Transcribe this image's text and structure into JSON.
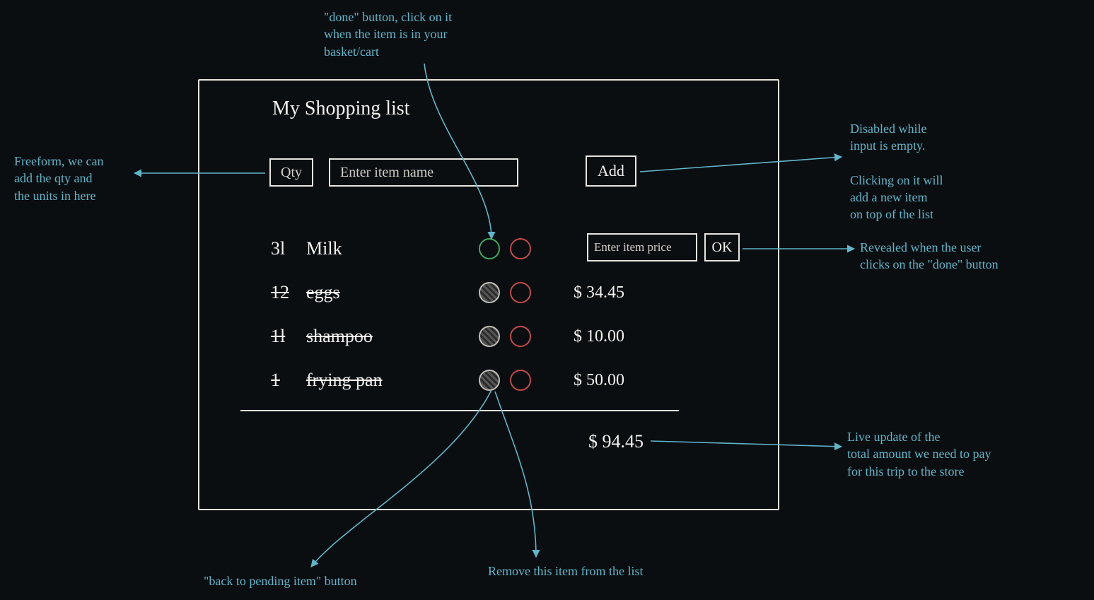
{
  "title": "My Shopping list",
  "inputs": {
    "qty_placeholder": "Qty",
    "name_placeholder": "Enter item name",
    "add_label": "Add",
    "price_placeholder": "Enter item price",
    "ok_label": "OK"
  },
  "items": [
    {
      "qty": "3l",
      "name": "Milk",
      "done": false,
      "price": ""
    },
    {
      "qty": "12",
      "name": "eggs",
      "done": true,
      "price": "$ 34.45"
    },
    {
      "qty": "1l",
      "name": "shampoo",
      "done": true,
      "price": "$ 10.00"
    },
    {
      "qty": "1",
      "name": "frying pan",
      "done": true,
      "price": "$ 50.00"
    }
  ],
  "total": "$ 94.45",
  "annotations": {
    "done": "\"done\" button, click on it\nwhen the item is in your\nbasket/cart",
    "qty": "Freeform, we can\nadd the qty and\nthe units in here",
    "add": "Disabled while\ninput is empty.\n\nClicking on it will\nadd a new item\non top of the list",
    "price": "Revealed when the user\nclicks on the \"done\" button",
    "total": "Live update of the\ntotal amount we need to pay\nfor this trip to the store",
    "remove": "Remove this item from the list",
    "pending": "\"back to pending item\" button"
  }
}
